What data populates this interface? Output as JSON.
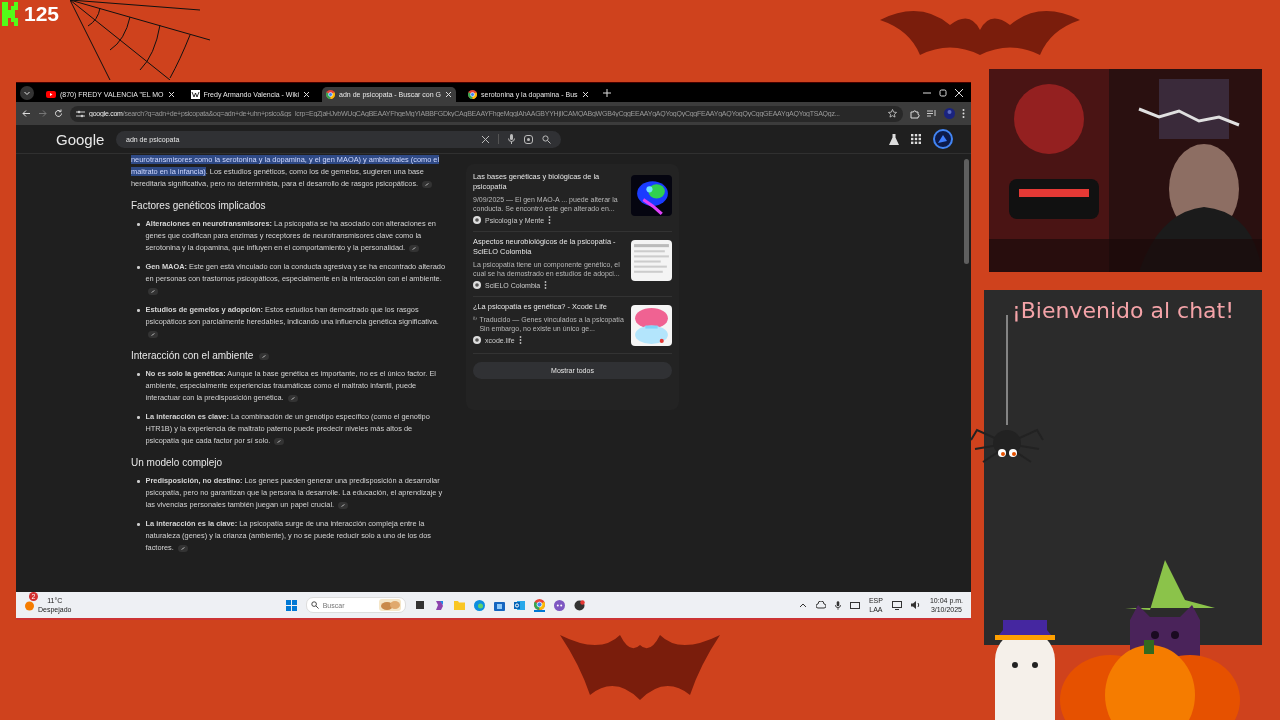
{
  "stream_overlay": {
    "viewer_count": "125"
  },
  "browser": {
    "tabs": [
      {
        "title": "(870) FREDY VALENCIA \"EL MO",
        "kind": "video",
        "selected": false
      },
      {
        "title": "Fredy Armando Valencia - Wiki",
        "kind": "wiki",
        "selected": false
      },
      {
        "title": "adn de psicopata - Buscar con G",
        "kind": "google",
        "selected": true
      },
      {
        "title": "serotonina y la dopamina - Bus",
        "kind": "google",
        "selected": false
      }
    ],
    "address": {
      "domain": "google.com",
      "path": "/search?q=adn+de+psicopata&oq=adn+de+uhn+psico&gs_lcrp=EgZjaHJvbWUqCAgBEAAYFhgeMgYIABBFGDkyCAgBEAAYFhgeMggIAhAAGBYYHjIICAMQABgWGB4yCggEEAAYgAQYogQyCggFEAAYgAQYogQyCggGEAAYgAQYogTSAQgz..."
    },
    "search": {
      "logo": "Google",
      "query": "adn de psicopata"
    }
  },
  "article": {
    "intro": {
      "highlighted": "neurotransmisores como la serotonina y la dopamina, y el gen MAOA) y ambientales (como el maltrato en la infancia)",
      "text": ". Los estudios genéticos, como los de gemelos, sugieren una base hereditaria significativa, pero no determinista, para el desarrollo de rasgos psicopáticos."
    },
    "sections": [
      {
        "heading": "Factores genéticos implicados",
        "has_link": false,
        "items": [
          "**Alteraciones en neurotransmisores:** La psicopatía se ha asociado con alteraciones en genes que codifican para enzimas y receptores de neurotransmisores clave como la serotonina y la dopamina, que influyen en el comportamiento y la personalidad.",
          "**Gen MAOA:** Este gen está vinculado con la conducta agresiva y se ha encontrado alterado en personas con trastornos psicopáticos, especialmente en la interacción con el ambiente.",
          "**Estudios de gemelos y adopción:** Estos estudios han demostrado que los rasgos psicopáticos son parcialmente heredables, indicando una influencia genética significativa."
        ]
      },
      {
        "heading": "Interacción con el ambiente",
        "has_link": true,
        "items": [
          "**No es solo la genética:** Aunque la base genética es importante, no es el único factor. El ambiente, especialmente experiencias traumáticas como el maltrato infantil, puede interactuar con la predisposición genética.",
          "**La interacción es clave:** La combinación de un genotipo específico (como el genotipo HTR1B) y la experiencia de maltrato paterno puede predecir niveles más altos de psicopatía que cada factor por sí solo."
        ]
      },
      {
        "heading": "Un modelo complejo",
        "has_link": false,
        "items": [
          "**Predisposición, no destino:** Los genes pueden generar una predisposición a desarrollar psicopatía, pero no garantizan que la persona la desarrolle. La educación, el aprendizaje y las vivencias personales también juegan un papel crucial.",
          "**La interacción es la clave:** La psicopatía surge de una interacción compleja entre la naturaleza (genes) y la crianza (ambiente), y no se puede reducir solo a uno de los dos factores."
        ]
      }
    ]
  },
  "sources": {
    "results": [
      {
        "title": "Las bases genéticas y biológicas de la psicopatía",
        "snippet": "9/09/2025 — El gen MAO-A ... puede alterar la conducta. Se encontró este gen alterado en...",
        "source": "Psicología y Mente",
        "translated": false
      },
      {
        "title": "Aspectos neurobiológicos de la psicopatía - SciELO Colombia",
        "snippet": "La psicopatía tiene un componente genético, el cual se ha demostrado en estudios de adopci...",
        "source": "SciELO Colombia",
        "translated": false
      },
      {
        "title": "¿La psicopatía es genética? - Xcode Life",
        "snippet": "Traducido — Genes vinculados a la psicopatía Sin embargo, no existe un único ge...",
        "source": "xcode.life",
        "translated": true
      }
    ],
    "show_all": "Mostrar todos"
  },
  "taskbar": {
    "weather_badge": "2",
    "temperature": "11°C",
    "condition": "Despejado",
    "search_placeholder": "Buscar",
    "language": "ESP",
    "layout": "LAA",
    "time": "10:04 p.m.",
    "date": "3/10/2025"
  },
  "chat": {
    "title": "¡Bienvenido al chat!"
  }
}
